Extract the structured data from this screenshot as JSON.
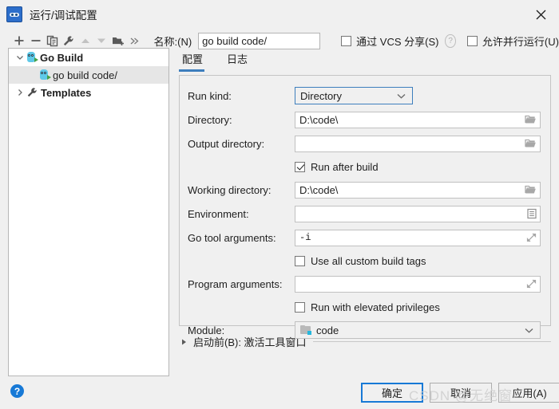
{
  "window": {
    "title": "运行/调试配置",
    "app_icon": "go-logo-icon",
    "close_label": "✕"
  },
  "toolbar": {
    "buttons": [
      {
        "name": "add-button",
        "icon": "plus-icon"
      },
      {
        "name": "remove-button",
        "icon": "minus-icon"
      },
      {
        "name": "copy-button",
        "icon": "copy-icon"
      },
      {
        "name": "edit-templates-button",
        "icon": "wrench-icon"
      },
      {
        "name": "move-up-button",
        "icon": "arrow-up-icon"
      },
      {
        "name": "move-down-button",
        "icon": "arrow-down-icon"
      },
      {
        "name": "move-into-folder-button",
        "icon": "folder-add-icon"
      },
      {
        "name": "more-button",
        "icon": "chevron-double-right-icon"
      }
    ],
    "name_label": "名称:(N)",
    "name_value": "go build code/",
    "share_vcs_label": "通过 VCS 分享(S)",
    "share_vcs_checked": false,
    "share_help_icon": "?",
    "allow_parallel_label": "允许并行运行(U)",
    "allow_parallel_checked": false
  },
  "tree": {
    "items": [
      {
        "label": "Go Build",
        "icon": "go-run-icon",
        "expander": "chevron-down-icon",
        "bold": true,
        "selected": false,
        "indent": 0
      },
      {
        "label": "go build code/",
        "icon": "go-run-icon",
        "expander": "",
        "bold": false,
        "selected": true,
        "indent": 1
      },
      {
        "label": "Templates",
        "icon": "wrench-icon",
        "expander": "chevron-right-icon",
        "bold": true,
        "selected": false,
        "indent": 0
      }
    ]
  },
  "tabs": [
    {
      "label": "配置",
      "active": true
    },
    {
      "label": "日志",
      "active": false
    }
  ],
  "form": {
    "run_kind": {
      "label": "Run kind:",
      "value": "Directory",
      "icon": "chevron-down-icon"
    },
    "directory": {
      "label": "Directory:",
      "value": "D:\\code\\",
      "icon": "folder-open-icon"
    },
    "output_directory": {
      "label": "Output directory:",
      "value": "",
      "icon": "folder-open-icon"
    },
    "run_after_build": {
      "label": "Run after build",
      "checked": true
    },
    "working_directory": {
      "label": "Working directory:",
      "value": "D:\\code\\",
      "icon": "folder-open-icon"
    },
    "environment": {
      "label": "Environment:",
      "value": "",
      "icon": "list-edit-icon"
    },
    "go_tool_arguments": {
      "label": "Go tool arguments:",
      "value": "-i",
      "icon": "expand-icon"
    },
    "use_custom_build_tags": {
      "label": "Use all custom build tags",
      "checked": false
    },
    "program_arguments": {
      "label": "Program arguments:",
      "value": "",
      "icon": "expand-icon"
    },
    "run_elevated": {
      "label": "Run with elevated privileges",
      "checked": false
    },
    "module": {
      "label": "Module:",
      "value": "code",
      "icon": "chevron-down-icon",
      "item_icon": "module-folder-icon"
    }
  },
  "before_launch": {
    "expander": "triangle-right-icon",
    "text": "启动前(B): 激活工具窗口"
  },
  "footer": {
    "help_icon": "?",
    "ok_label": "确定",
    "cancel_label": "取消",
    "apply_label": "应用(A)",
    "watermark": "CSDN @无绝窗"
  },
  "colors": {
    "accent": "#3d7ebd",
    "primary_button_border": "#1779d6",
    "selection": "#e6e6e6",
    "window_bg": "#f0f0f0"
  }
}
